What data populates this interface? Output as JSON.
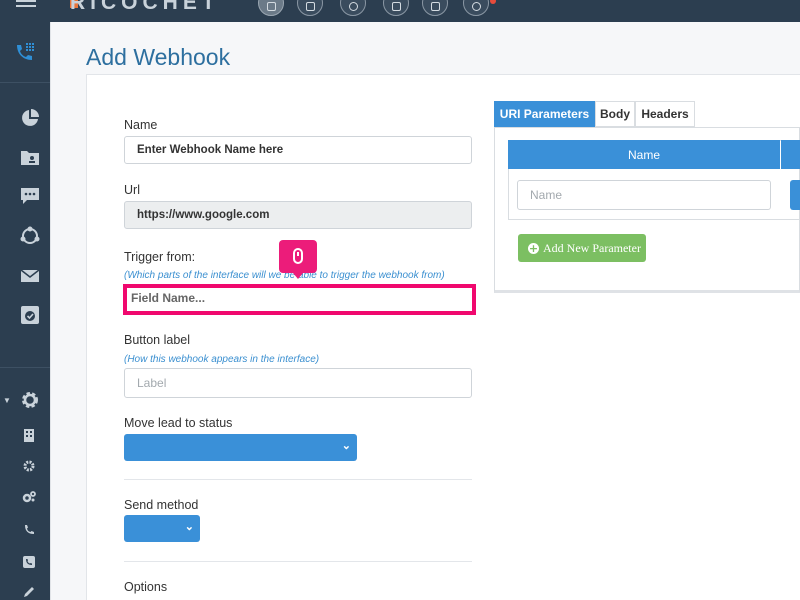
{
  "app": {
    "brand": "RICOCHET",
    "page_title": "Add Webhook"
  },
  "form": {
    "name_label": "Name",
    "name_value": "Enter Webhook Name here",
    "url_label": "Url",
    "url_value": "https://www.google.com",
    "trigger_label": "Trigger from:",
    "trigger_hint": "(Which parts of the interface will we be able to trigger the webhook from)",
    "trigger_placeholder": "Field Name...",
    "button_label_label": "Button label",
    "button_label_hint": "(How this webhook appears in the interface)",
    "button_label_placeholder": "Label",
    "move_status_label": "Move lead to status",
    "move_status_value": "",
    "send_method_label": "Send method",
    "send_method_value": "",
    "options_label": "Options"
  },
  "tabs": {
    "items": [
      "URI Parameters",
      "Body",
      "Headers"
    ],
    "active": "URI Parameters"
  },
  "params": {
    "name_header": "Name",
    "name_placeholder": "Name",
    "add_button": "Add New Parameter"
  },
  "colors": {
    "accent_blue": "#3a90d8",
    "highlight_pink": "#f0086e",
    "add_green": "#7cbf62",
    "sidebar_bg": "#2c3e50"
  }
}
